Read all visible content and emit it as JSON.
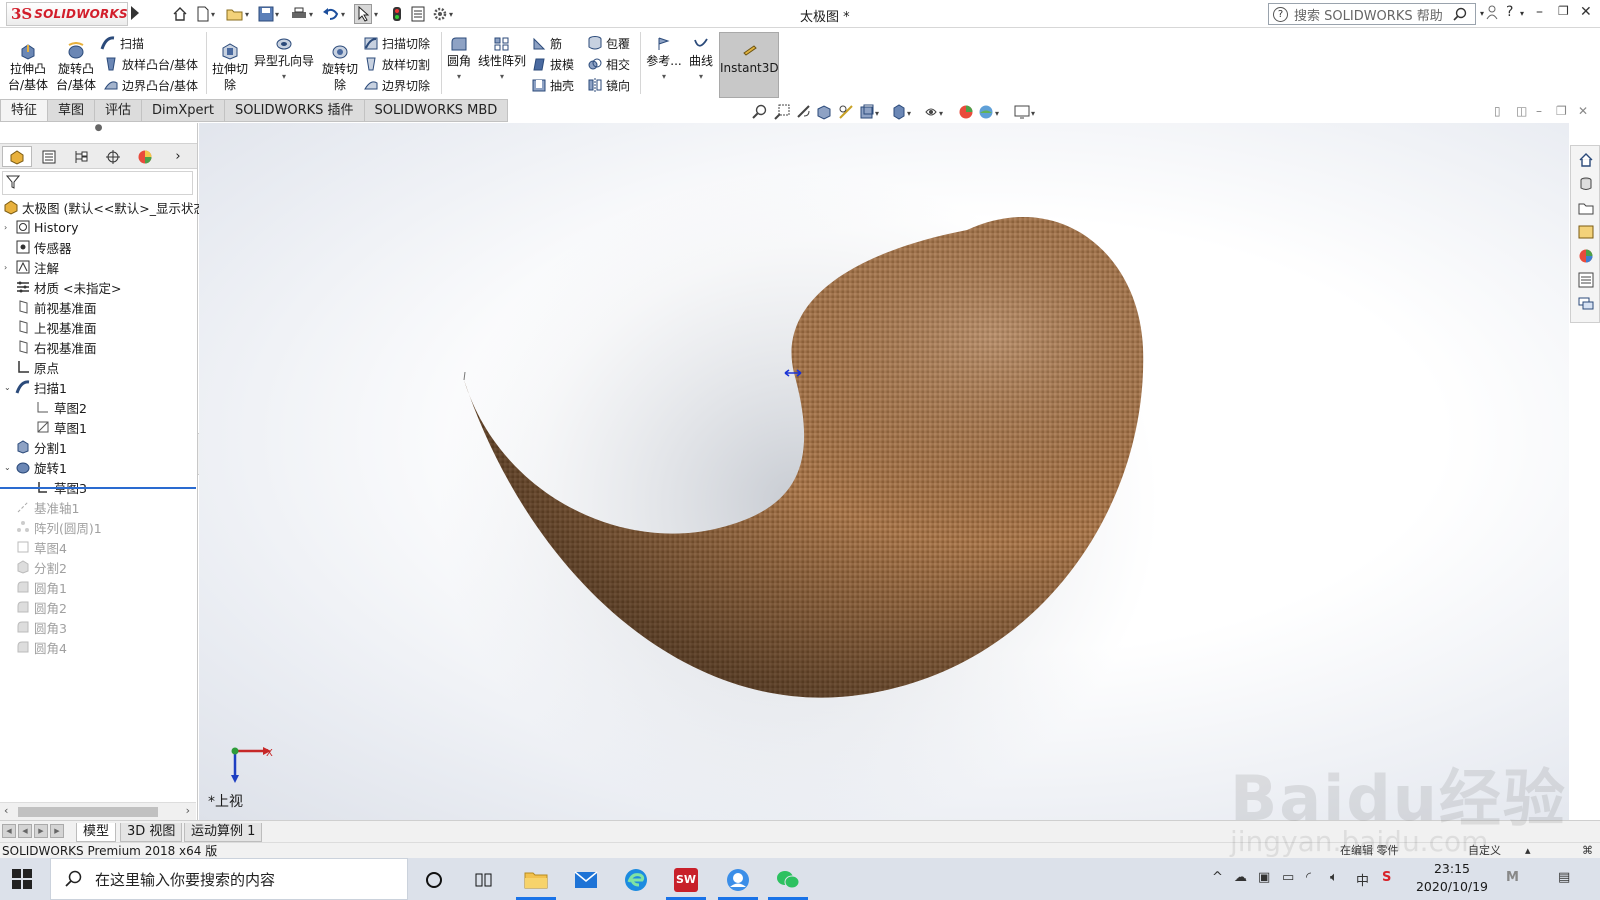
{
  "app": {
    "brand_ds": "3S",
    "brand_name": "SOLIDWORKS",
    "doc_title": "太极图 *",
    "help_search_placeholder": "搜索 SOLIDWORKS 帮助"
  },
  "commands": {
    "extrude_boss": "拉伸凸\n台/基体",
    "revolve_boss": "旋转凸\n台/基体",
    "sweep": "扫描",
    "loft": "放样凸台/基体",
    "boundary_boss": "边界凸台/基体",
    "extrude_cut": "拉伸切\n除",
    "hole_wizard": "异型孔向导",
    "revolve_cut": "旋转切\n除",
    "swept_cut": "扫描切除",
    "lofted_cut": "放样切割",
    "boundary_cut": "边界切除",
    "fillet": "圆角",
    "linear_pattern": "线性阵列",
    "rib": "筋",
    "draft": "拔模",
    "shell": "抽壳",
    "wrap": "包覆",
    "intersect": "相交",
    "mirror": "镜向",
    "reference": "参考...",
    "curves": "曲线",
    "instant3d": "Instant3D"
  },
  "tabs": [
    "特征",
    "草图",
    "评估",
    "DimXpert",
    "SOLIDWORKS 插件",
    "SOLIDWORKS MBD"
  ],
  "tree": {
    "root": "太极图 (默认<<默认>_显示状态",
    "items": [
      {
        "label": "History",
        "icon": "history-icon"
      },
      {
        "label": "传感器",
        "icon": "sensor-icon"
      },
      {
        "label": "注解",
        "icon": "annotation-icon"
      },
      {
        "label": "材质 <未指定>",
        "icon": "material-icon"
      },
      {
        "label": "前视基准面",
        "icon": "plane-icon"
      },
      {
        "label": "上视基准面",
        "icon": "plane-icon"
      },
      {
        "label": "右视基准面",
        "icon": "plane-icon"
      },
      {
        "label": "原点",
        "icon": "origin-icon"
      },
      {
        "label": "扫描1",
        "icon": "sweep-feature-icon"
      },
      {
        "label": "草图2",
        "icon": "sketch-icon"
      },
      {
        "label": "草图1",
        "icon": "sketch-icon"
      },
      {
        "label": "分割1",
        "icon": "split-icon"
      },
      {
        "label": "旋转1",
        "icon": "revolve-feature-icon"
      },
      {
        "label": "草图3",
        "icon": "sketch-icon"
      },
      {
        "label": "基准轴1",
        "icon": "axis-icon"
      },
      {
        "label": "阵列(圆周)1",
        "icon": "pattern-icon"
      },
      {
        "label": "草图4",
        "icon": "sketch-icon"
      },
      {
        "label": "分割2",
        "icon": "split-icon"
      },
      {
        "label": "圆角1",
        "icon": "fillet-icon"
      },
      {
        "label": "圆角2",
        "icon": "fillet-icon"
      },
      {
        "label": "圆角3",
        "icon": "fillet-icon"
      },
      {
        "label": "圆角4",
        "icon": "fillet-icon"
      }
    ]
  },
  "viewport": {
    "view_name": "*上视",
    "axis_x": "X",
    "material_color": "#9b6b3f"
  },
  "model_tabs": [
    "模型",
    "3D 视图",
    "运动算例 1"
  ],
  "status": {
    "version": "SOLIDWORKS Premium 2018 x64 版",
    "editing": "在编辑 零件",
    "custom": "自定义"
  },
  "taskbar": {
    "search_placeholder": "在这里输入你要搜索的内容",
    "ime": "中",
    "time": "23:15",
    "date": "2020/10/19"
  },
  "watermark": {
    "line1": "Baidu经验",
    "line2": "jingyan.baidu.com"
  }
}
